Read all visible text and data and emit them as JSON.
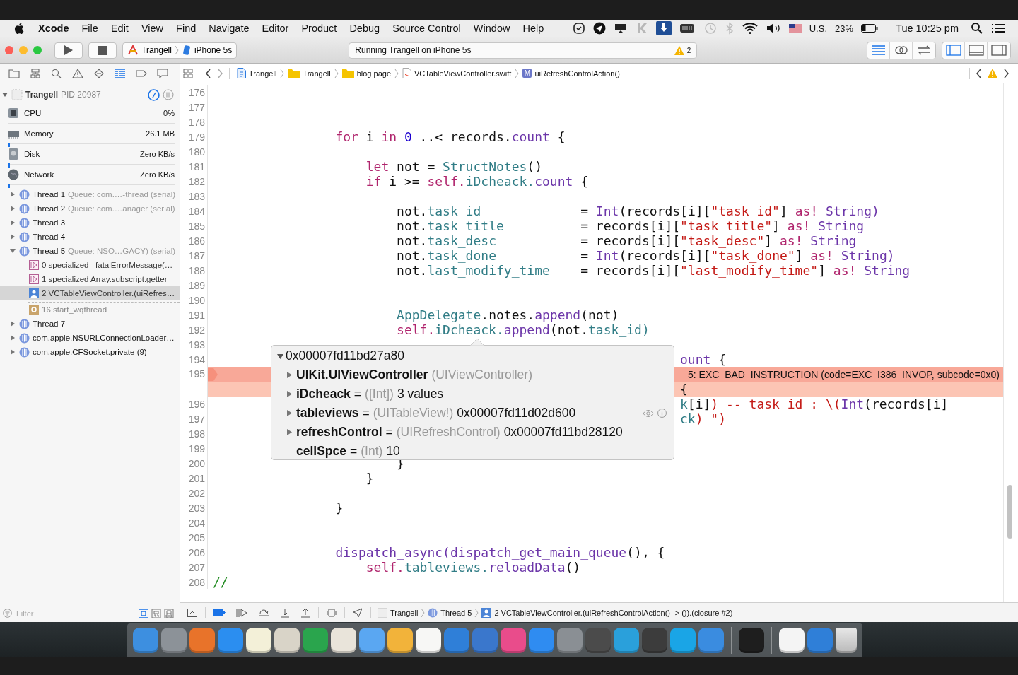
{
  "menu_bar": {
    "app": "Xcode",
    "menus": [
      "File",
      "Edit",
      "View",
      "Find",
      "Navigate",
      "Editor",
      "Product",
      "Debug",
      "Source Control",
      "Window",
      "Help"
    ],
    "input_source": "U.S.",
    "battery": "23%",
    "clock": "Tue 10:25 pm"
  },
  "toolbar": {
    "target": "Trangell",
    "device": "iPhone 5s",
    "activity": "Running Trangell on iPhone 5s",
    "warning_count": "2",
    "editor_modes": [
      {
        "kind": "standard",
        "selected": true
      },
      {
        "kind": "assistant",
        "selected": false
      },
      {
        "kind": "version",
        "selected": false
      }
    ],
    "panels": [
      {
        "kind": "navigator",
        "on": true
      },
      {
        "kind": "debug",
        "on": false
      },
      {
        "kind": "utilities",
        "on": false
      }
    ]
  },
  "navigator": {
    "tabs": [
      {
        "kind": "project",
        "selected": false
      },
      {
        "kind": "symbol",
        "selected": false
      },
      {
        "kind": "find",
        "selected": false
      },
      {
        "kind": "issue",
        "selected": false
      },
      {
        "kind": "test",
        "selected": false
      },
      {
        "kind": "debug",
        "selected": true
      },
      {
        "kind": "breakpoint",
        "selected": false
      },
      {
        "kind": "report",
        "selected": false
      }
    ],
    "process": {
      "name": "Trangell",
      "pid": "PID 20987",
      "expanded": true
    },
    "gauges": [
      {
        "kind": "cpu",
        "name": "CPU",
        "value": "0%",
        "graph": false
      },
      {
        "kind": "memory",
        "name": "Memory",
        "value": "26.1 MB",
        "graph": true
      },
      {
        "kind": "disk",
        "name": "Disk",
        "value": "Zero KB/s",
        "graph": true
      },
      {
        "kind": "network",
        "name": "Network",
        "value": "Zero KB/s",
        "graph": true
      }
    ],
    "threads": [
      {
        "label": "Thread 1",
        "queue": "Queue: com.…-thread (serial)",
        "expanded": false
      },
      {
        "label": "Thread 2",
        "queue": "Queue: com.…anager (serial)",
        "expanded": false
      },
      {
        "label": "Thread 3",
        "expanded": false
      },
      {
        "label": "Thread 4",
        "expanded": false
      },
      {
        "label": "Thread 5",
        "queue": "Queue: NSO…GACY) (serial)",
        "expanded": true,
        "children": [
          {
            "kind": "system",
            "label": "0 specialized _fatalErrorMessage(…",
            "selected": false
          },
          {
            "kind": "system",
            "label": "1 specialized Array.subscript.getter",
            "selected": false
          },
          {
            "kind": "user",
            "label": "2 VCTableViewController.(uiRefres…",
            "selected": true
          },
          {
            "kind": "runtime",
            "label": "16 start_wqthread",
            "selected": false
          }
        ]
      },
      {
        "label": "Thread 7",
        "expanded": false
      },
      {
        "label": "com.apple.NSURLConnectionLoader…",
        "expanded": false
      },
      {
        "label": "com.apple.CFSocket.private (9)",
        "expanded": false
      }
    ],
    "filter": {
      "placeholder": "Filter"
    }
  },
  "editor": {
    "jump_bar": [
      {
        "kind": "project",
        "label": "Trangell"
      },
      {
        "kind": "folder",
        "label": "Trangell"
      },
      {
        "kind": "folder",
        "label": "blog page"
      },
      {
        "kind": "swift",
        "label": "VCTableViewController.swift"
      },
      {
        "kind": "method",
        "badge": "M",
        "label": "uiRefreshControlAction()"
      }
    ],
    "lines": [
      {
        "n": "176"
      },
      {
        "n": "177"
      },
      {
        "n": "178"
      },
      {
        "n": "179",
        "kind": "outer",
        "tokens": [
          {
            "kind": "kw",
            "text": "for"
          },
          {
            "kind": "p",
            "text": " i "
          },
          {
            "kind": "kw",
            "text": "in "
          },
          {
            "kind": "num",
            "text": "0"
          },
          {
            "kind": "p",
            "text": " ..< records."
          },
          {
            "kind": "type",
            "text": "count"
          },
          {
            "kind": "p",
            "text": " {"
          }
        ]
      },
      {
        "n": "180"
      },
      {
        "n": "181",
        "kind": "mid",
        "tokens": [
          {
            "kind": "kw",
            "text": "let"
          },
          {
            "kind": "p",
            "text": " not = "
          },
          {
            "kind": "prop",
            "text": "StructNotes"
          },
          {
            "kind": "p",
            "text": "()"
          }
        ]
      },
      {
        "n": "182",
        "kind": "mid",
        "tokens": [
          {
            "kind": "kw",
            "text": "if"
          },
          {
            "kind": "p",
            "text": " i >= "
          },
          {
            "kind": "kw",
            "text": "self."
          },
          {
            "kind": "prop",
            "text": "iDcheack."
          },
          {
            "kind": "type",
            "text": "count"
          },
          {
            "kind": "p",
            "text": " {"
          }
        ]
      },
      {
        "n": "183"
      },
      {
        "n": "184",
        "kind": "inner",
        "tokens": [
          {
            "kind": "p",
            "text": "not."
          },
          {
            "kind": "prop",
            "text": "task_id"
          },
          {
            "kind": "p",
            "text": "             = "
          },
          {
            "kind": "type",
            "text": "Int"
          },
          {
            "kind": "p",
            "text": "(records[i]["
          },
          {
            "kind": "str",
            "text": "\"task_id\""
          },
          {
            "kind": "p",
            "text": "] "
          },
          {
            "kind": "kw",
            "text": "as! "
          },
          {
            "kind": "type",
            "text": "String)"
          }
        ]
      },
      {
        "n": "185",
        "kind": "inner",
        "tokens": [
          {
            "kind": "p",
            "text": "not."
          },
          {
            "kind": "prop",
            "text": "task_title"
          },
          {
            "kind": "p",
            "text": "          = records[i]["
          },
          {
            "kind": "str",
            "text": "\"task_title\""
          },
          {
            "kind": "p",
            "text": "] "
          },
          {
            "kind": "kw",
            "text": "as! "
          },
          {
            "kind": "type",
            "text": "String"
          }
        ]
      },
      {
        "n": "186",
        "kind": "inner",
        "tokens": [
          {
            "kind": "p",
            "text": "not."
          },
          {
            "kind": "prop",
            "text": "task_desc"
          },
          {
            "kind": "p",
            "text": "           = records[i]["
          },
          {
            "kind": "str",
            "text": "\"task_desc\""
          },
          {
            "kind": "p",
            "text": "] "
          },
          {
            "kind": "kw",
            "text": "as! "
          },
          {
            "kind": "type",
            "text": "String"
          }
        ]
      },
      {
        "n": "187",
        "kind": "inner",
        "tokens": [
          {
            "kind": "p",
            "text": "not."
          },
          {
            "kind": "prop",
            "text": "task_done"
          },
          {
            "kind": "p",
            "text": "           = "
          },
          {
            "kind": "type",
            "text": "Int"
          },
          {
            "kind": "p",
            "text": "(records[i]["
          },
          {
            "kind": "str",
            "text": "\"task_done\""
          },
          {
            "kind": "p",
            "text": "] "
          },
          {
            "kind": "kw",
            "text": "as! "
          },
          {
            "kind": "type",
            "text": "String)"
          }
        ]
      },
      {
        "n": "188",
        "kind": "inner",
        "tokens": [
          {
            "kind": "p",
            "text": "not."
          },
          {
            "kind": "prop",
            "text": "last_modify_time"
          },
          {
            "kind": "p",
            "text": "    = records[i]["
          },
          {
            "kind": "str",
            "text": "\"last_modify_time\""
          },
          {
            "kind": "p",
            "text": "] "
          },
          {
            "kind": "kw",
            "text": "as! "
          },
          {
            "kind": "type",
            "text": "String"
          }
        ]
      },
      {
        "n": "189"
      },
      {
        "n": "190"
      },
      {
        "n": "191",
        "kind": "inner",
        "tokens": [
          {
            "kind": "prop",
            "text": "AppDelegate"
          },
          {
            "kind": "p",
            "text": ".notes."
          },
          {
            "kind": "type",
            "text": "append"
          },
          {
            "kind": "p",
            "text": "(not)"
          }
        ]
      },
      {
        "n": "192",
        "kind": "inner",
        "tokens": [
          {
            "kind": "kw",
            "text": "self."
          },
          {
            "kind": "prop",
            "text": "iDcheack."
          },
          {
            "kind": "type",
            "text": "append"
          },
          {
            "kind": "p",
            "text": "(not."
          },
          {
            "kind": "prop",
            "text": "task_id)"
          }
        ]
      },
      {
        "n": "193"
      },
      {
        "n": "194",
        "kind": "tail",
        "tokens": [
          {
            "kind": "type",
            "text": "ount"
          },
          {
            "kind": "p",
            "text": " {"
          }
        ]
      },
      {
        "n": "195",
        "kind": "error",
        "message": "5: EXC_BAD_INSTRUCTION (code=EXC_I386_INVOP, subcode=0x0)",
        "tokens": [
          {
            "kind": "p",
            "text": "{"
          }
        ]
      },
      {
        "n": "196",
        "kind": "tail",
        "tokens": [
          {
            "kind": "prop",
            "text": "k"
          },
          {
            "kind": "p",
            "text": "[i]"
          },
          {
            "kind": "str",
            "text": ") -- task_id : \\("
          },
          {
            "kind": "type",
            "text": "Int"
          },
          {
            "kind": "p",
            "text": "(records[i]"
          }
        ]
      },
      {
        "n": "197",
        "kind": "tail",
        "tokens": [
          {
            "kind": "prop",
            "text": "ck"
          },
          {
            "kind": "str",
            "text": ") \")"
          }
        ]
      },
      {
        "n": "198"
      },
      {
        "n": "199"
      },
      {
        "n": "200",
        "kind": "inner",
        "tokens": [
          {
            "kind": "p",
            "text": "}"
          }
        ]
      },
      {
        "n": "201",
        "kind": "mid",
        "tokens": [
          {
            "kind": "p",
            "text": "}"
          }
        ]
      },
      {
        "n": "202"
      },
      {
        "n": "203",
        "kind": "outer",
        "tokens": [
          {
            "kind": "p",
            "text": "}"
          }
        ]
      },
      {
        "n": "204"
      },
      {
        "n": "205"
      },
      {
        "n": "206",
        "kind": "outer",
        "tokens": [
          {
            "kind": "type",
            "text": "dispatch_async("
          },
          {
            "kind": "type",
            "text": "dispatch_get_main_queue"
          },
          {
            "kind": "p",
            "text": "(), {"
          }
        ]
      },
      {
        "n": "207",
        "kind": "mid",
        "tokens": [
          {
            "kind": "kw",
            "text": "self."
          },
          {
            "kind": "prop",
            "text": "tableviews."
          },
          {
            "kind": "type",
            "text": "reloadData"
          },
          {
            "kind": "p",
            "text": "()"
          }
        ]
      },
      {
        "n": "208",
        "kind": "plain",
        "tokens": [
          {
            "kind": "com",
            "text": "//"
          }
        ]
      }
    ],
    "inspector": {
      "address": "0x00007fd11bd27a80",
      "expanded": true,
      "members": [
        {
          "name": "UIKit.UIViewController",
          "type": "(UIViewController)",
          "expandable": true,
          "hovered": false
        },
        {
          "name": "iDcheack",
          "sep": "=",
          "type": "([Int])",
          "value": "3 values",
          "expandable": true,
          "hovered": false
        },
        {
          "name": "tableviews",
          "sep": "=",
          "type": "(UITableView!)",
          "value": "0x00007fd11d02d600",
          "expandable": true,
          "hovered": true
        },
        {
          "name": "refreshControl",
          "sep": "=",
          "type": "(UIRefreshControl)",
          "value": "0x00007fd11bd28120",
          "expandable": true,
          "hovered": false
        },
        {
          "name": "cellSpce",
          "sep": "=",
          "type": "(Int)",
          "value": "10",
          "expandable": false,
          "hovered": false
        }
      ]
    }
  },
  "debug_bar": {
    "breakpoints_active": true,
    "path": [
      {
        "kind": "project",
        "label": "Trangell"
      },
      {
        "kind": "thread",
        "label": "Thread 5"
      },
      {
        "kind": "frame",
        "label": "2 VCTableViewController.(uiRefreshControlAction() -> ()).(closure #2)"
      }
    ]
  }
}
